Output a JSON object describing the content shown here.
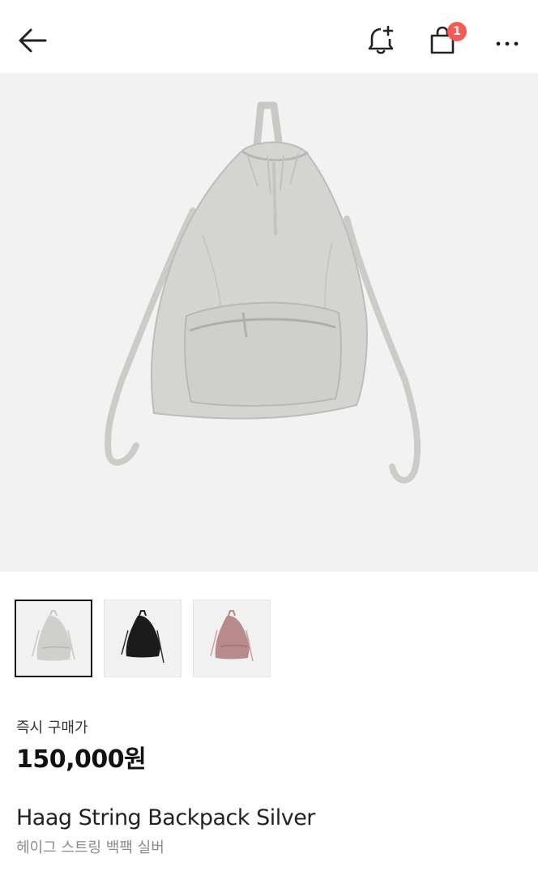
{
  "header": {
    "back_icon": "arrow-left-icon",
    "alert_icon": "bell-plus-icon",
    "bag_icon": "shopping-bag-icon",
    "bag_badge_count": "1",
    "more_icon": "more-horizontal-icon"
  },
  "gallery": {
    "main_image": "silver drawstring backpack",
    "thumbnails": [
      {
        "label": "Silver",
        "color": "#cfd0cb",
        "selected": true
      },
      {
        "label": "Black",
        "color": "#1b1b1b",
        "selected": false
      },
      {
        "label": "Pink",
        "color": "#b88a8c",
        "selected": false
      }
    ]
  },
  "price": {
    "label": "즉시 구매가",
    "value": "150,000원"
  },
  "product": {
    "name": "Haag String Backpack Silver",
    "name_ko": "헤이그 스트링 백팩 실버"
  },
  "colors": {
    "badge": "#f25c54",
    "hero_bg": "#f2f2f2"
  }
}
